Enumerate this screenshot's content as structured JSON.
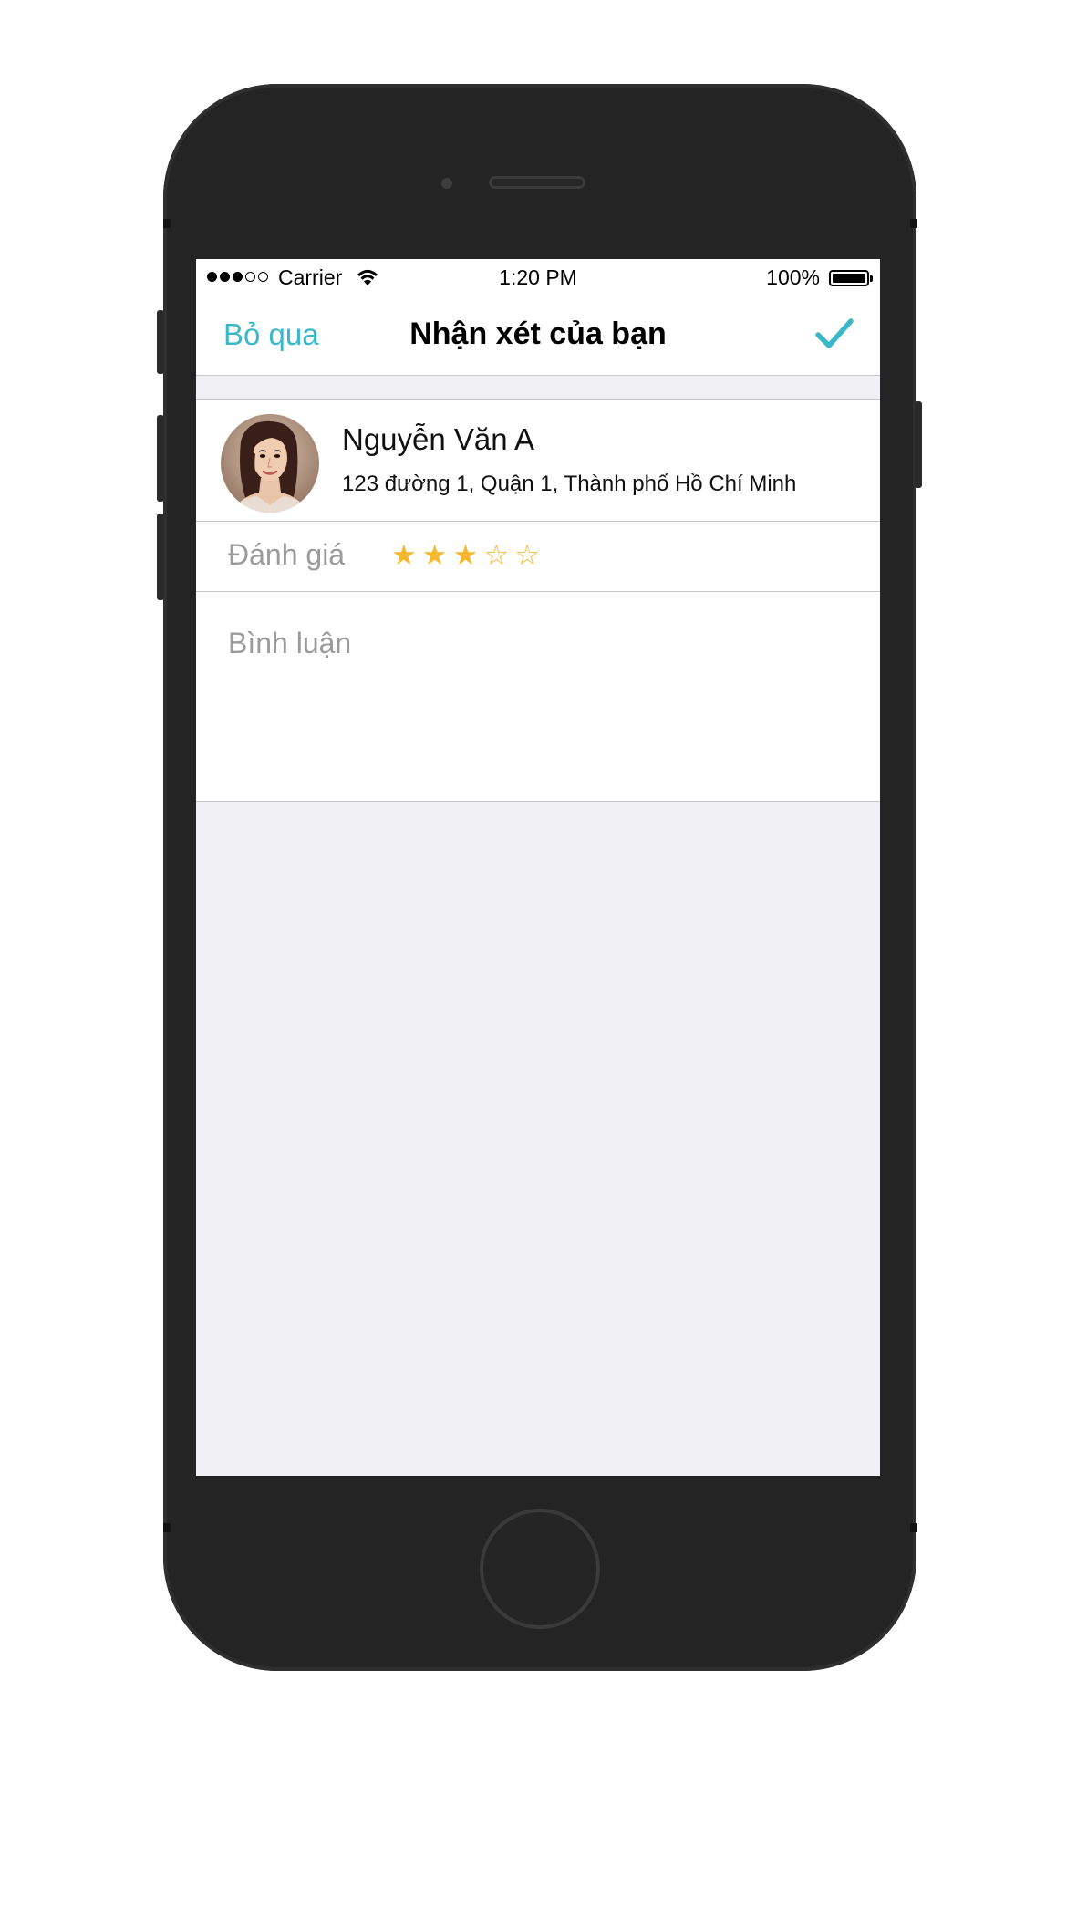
{
  "status_bar": {
    "carrier": "Carrier",
    "signal_bars_filled": 3,
    "signal_bars_total": 5,
    "time": "1:20 PM",
    "battery_percent": "100%",
    "battery_level": 1.0,
    "icons": [
      "signal-icon",
      "wifi-icon",
      "battery-icon"
    ]
  },
  "nav": {
    "cancel_label": "Bỏ qua",
    "title": "Nhận xét của bạn",
    "confirm_icon": "checkmark-icon"
  },
  "profile": {
    "name": "Nguyễn Văn A",
    "address": "123 đường 1, Quận 1, Thành phố Hồ Chí Minh",
    "avatar": "avatar-photo"
  },
  "rating": {
    "label": "Đánh giá",
    "value": 3,
    "max": 5,
    "filled_star": "★",
    "empty_star": "☆"
  },
  "comment": {
    "placeholder": "Bình luận",
    "value": ""
  },
  "colors": {
    "accent": "#3ab8c8",
    "star": "#f5b82e",
    "background": "#efeff4",
    "placeholder": "#9b9b9b"
  }
}
